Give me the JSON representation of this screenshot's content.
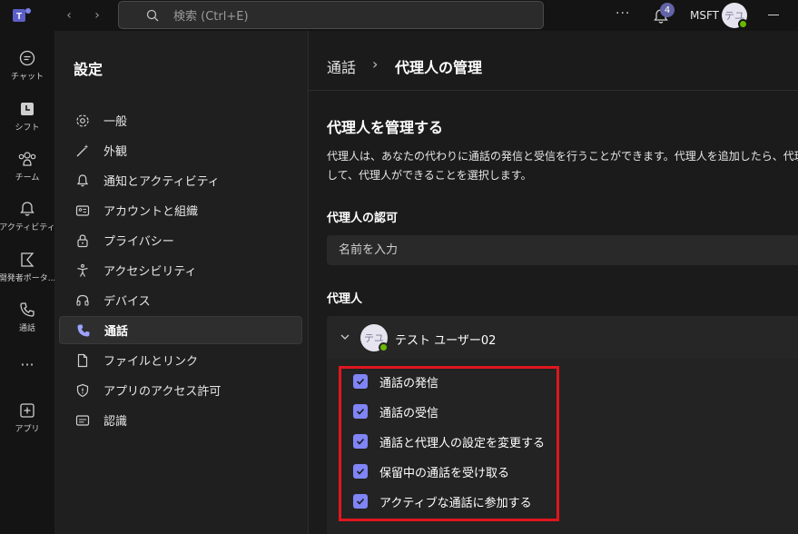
{
  "titlebar": {
    "search_placeholder": "検索 (Ctrl+E)",
    "more": "···",
    "notification_count": "4",
    "org_name": "MSFT",
    "user_initials": "テユ"
  },
  "rail": {
    "items": [
      {
        "label": "チャット",
        "icon": "chat-icon"
      },
      {
        "label": "シフト",
        "icon": "shifts-icon"
      },
      {
        "label": "チーム",
        "icon": "teams-icon"
      },
      {
        "label": "アクティビティ",
        "icon": "activity-icon"
      },
      {
        "label": "開発者ポータ...",
        "icon": "developer-portal-icon"
      },
      {
        "label": "通話",
        "icon": "calls-icon"
      },
      {
        "label": "···",
        "icon": "more-apps-icon"
      },
      {
        "label": "アプリ",
        "icon": "apps-icon"
      }
    ]
  },
  "settings": {
    "title": "設定",
    "menu": [
      {
        "label": "一般",
        "icon": "gear-icon"
      },
      {
        "label": "外観",
        "icon": "magic-wand-icon"
      },
      {
        "label": "通知とアクティビティ",
        "icon": "bell-icon"
      },
      {
        "label": "アカウントと組織",
        "icon": "id-card-icon"
      },
      {
        "label": "プライバシー",
        "icon": "lock-icon"
      },
      {
        "label": "アクセシビリティ",
        "icon": "accessibility-icon"
      },
      {
        "label": "デバイス",
        "icon": "headset-icon"
      },
      {
        "label": "通話",
        "icon": "phone-icon",
        "active": true
      },
      {
        "label": "ファイルとリンク",
        "icon": "file-icon"
      },
      {
        "label": "アプリのアクセス許可",
        "icon": "shield-icon"
      },
      {
        "label": "認識",
        "icon": "captions-icon"
      }
    ]
  },
  "main": {
    "breadcrumb": {
      "parent": "通話",
      "separator": "›",
      "current": "代理人の管理"
    },
    "section_title": "代理人を管理する",
    "description_line1": "代理人は、あなたの代わりに通話の発信と受信を行うことができます。代理人を追加したら、代理",
    "description_line2": "して、代理人ができることを選択します。",
    "authorize_heading": "代理人の認可",
    "name_placeholder": "名前を入力",
    "delegates_heading": "代理人",
    "delegate": {
      "initials": "テユ",
      "name": "テスト ユーザー02",
      "permissions": [
        {
          "label": "通話の発信",
          "checked": true
        },
        {
          "label": "通話の受信",
          "checked": true
        },
        {
          "label": "通話と代理人の設定を変更する",
          "checked": true
        },
        {
          "label": "保留中の通話を受け取る",
          "checked": true
        },
        {
          "label": "アクティブな通話に参加する",
          "checked": true
        }
      ]
    }
  },
  "colors": {
    "accent": "#7f85f5",
    "highlight_border": "#e0161e",
    "presence": "#6bb700",
    "badge": "#6264a7"
  }
}
